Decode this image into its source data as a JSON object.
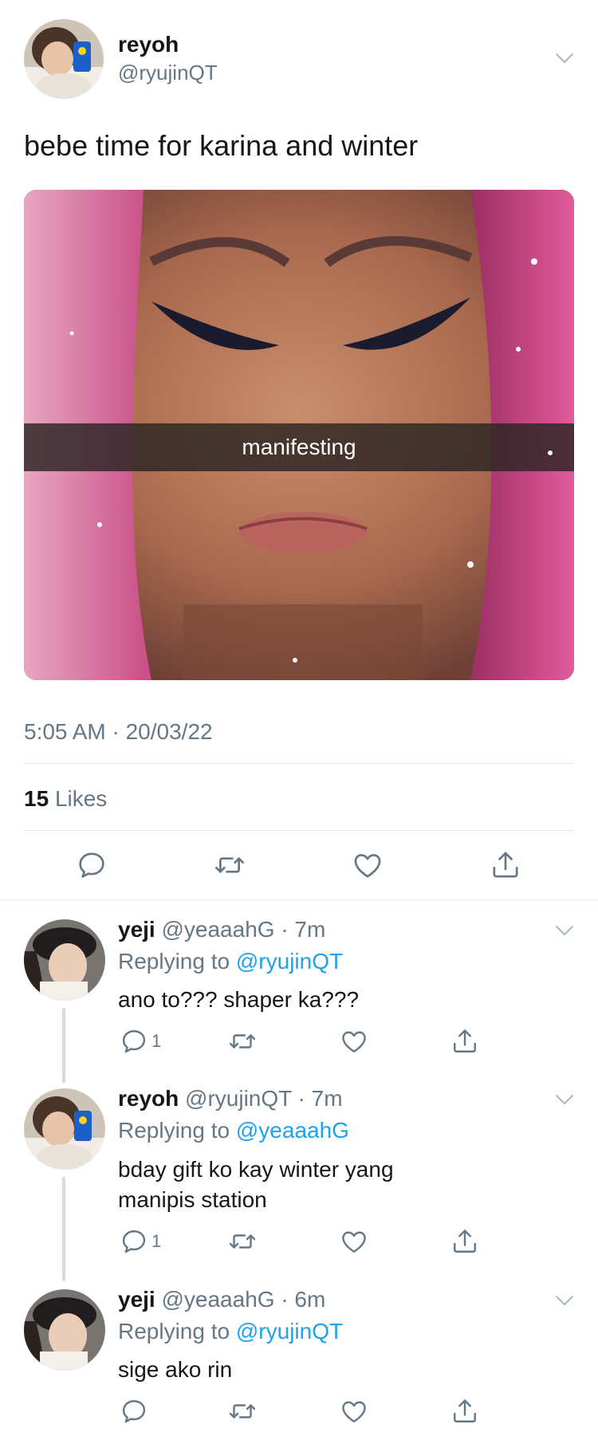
{
  "main_tweet": {
    "display_name": "reyoh",
    "handle": "@ryujinQT",
    "text": "bebe time for karina and winter",
    "image_caption": "manifesting",
    "timestamp": "5:05 AM · 20/03/22",
    "likes_count": "15",
    "likes_label": "Likes"
  },
  "replies": [
    {
      "display_name": "yeji",
      "handle_time": "@yeaaahG · 7m",
      "replying_prefix": "Replying to",
      "replying_to": "@ryujinQT",
      "text": "ano to??? shaper ka???",
      "reply_count": "1"
    },
    {
      "display_name": "reyoh",
      "handle_time": "@ryujinQT · 7m",
      "replying_prefix": "Replying to",
      "replying_to": "@yeaaahG",
      "text_line1": "bday gift ko kay winter yang",
      "text_line2": "manipis station",
      "reply_count": "1"
    },
    {
      "display_name": "yeji",
      "handle_time": "@yeaaahG · 6m",
      "replying_prefix": "Replying to",
      "replying_to": "@ryujinQT",
      "text": "sige ako rin",
      "reply_count": ""
    }
  ],
  "icons": [
    "chevron-down-icon",
    "reply-icon",
    "retweet-icon",
    "like-icon",
    "share-icon"
  ],
  "colors": {
    "text": "#14171a",
    "secondary": "#657786",
    "link": "#1da1f2",
    "divider": "#e1e8ed"
  }
}
